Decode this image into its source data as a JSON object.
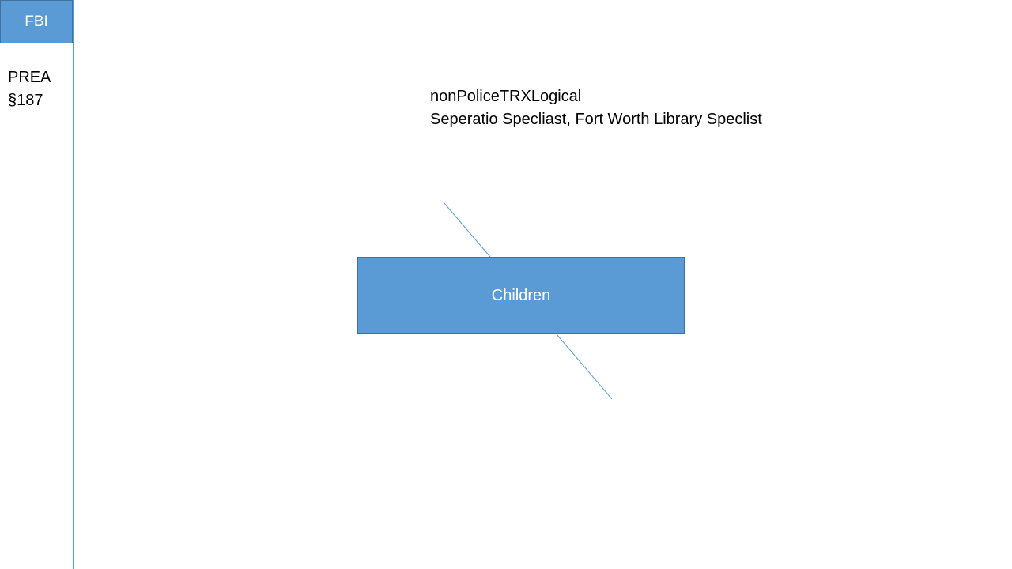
{
  "boxes": {
    "fbi": "FBI",
    "children": "Children"
  },
  "side_note": {
    "line1": "PREA",
    "line2": "§187"
  },
  "heading": {
    "line1": "nonPoliceTRXLogical",
    "line2": "Seperatio Specliast, Fort Worth Library Speclist"
  },
  "colors": {
    "box_fill": "#5b9bd5",
    "box_border": "#41719c",
    "line": "#5b9bd5"
  }
}
